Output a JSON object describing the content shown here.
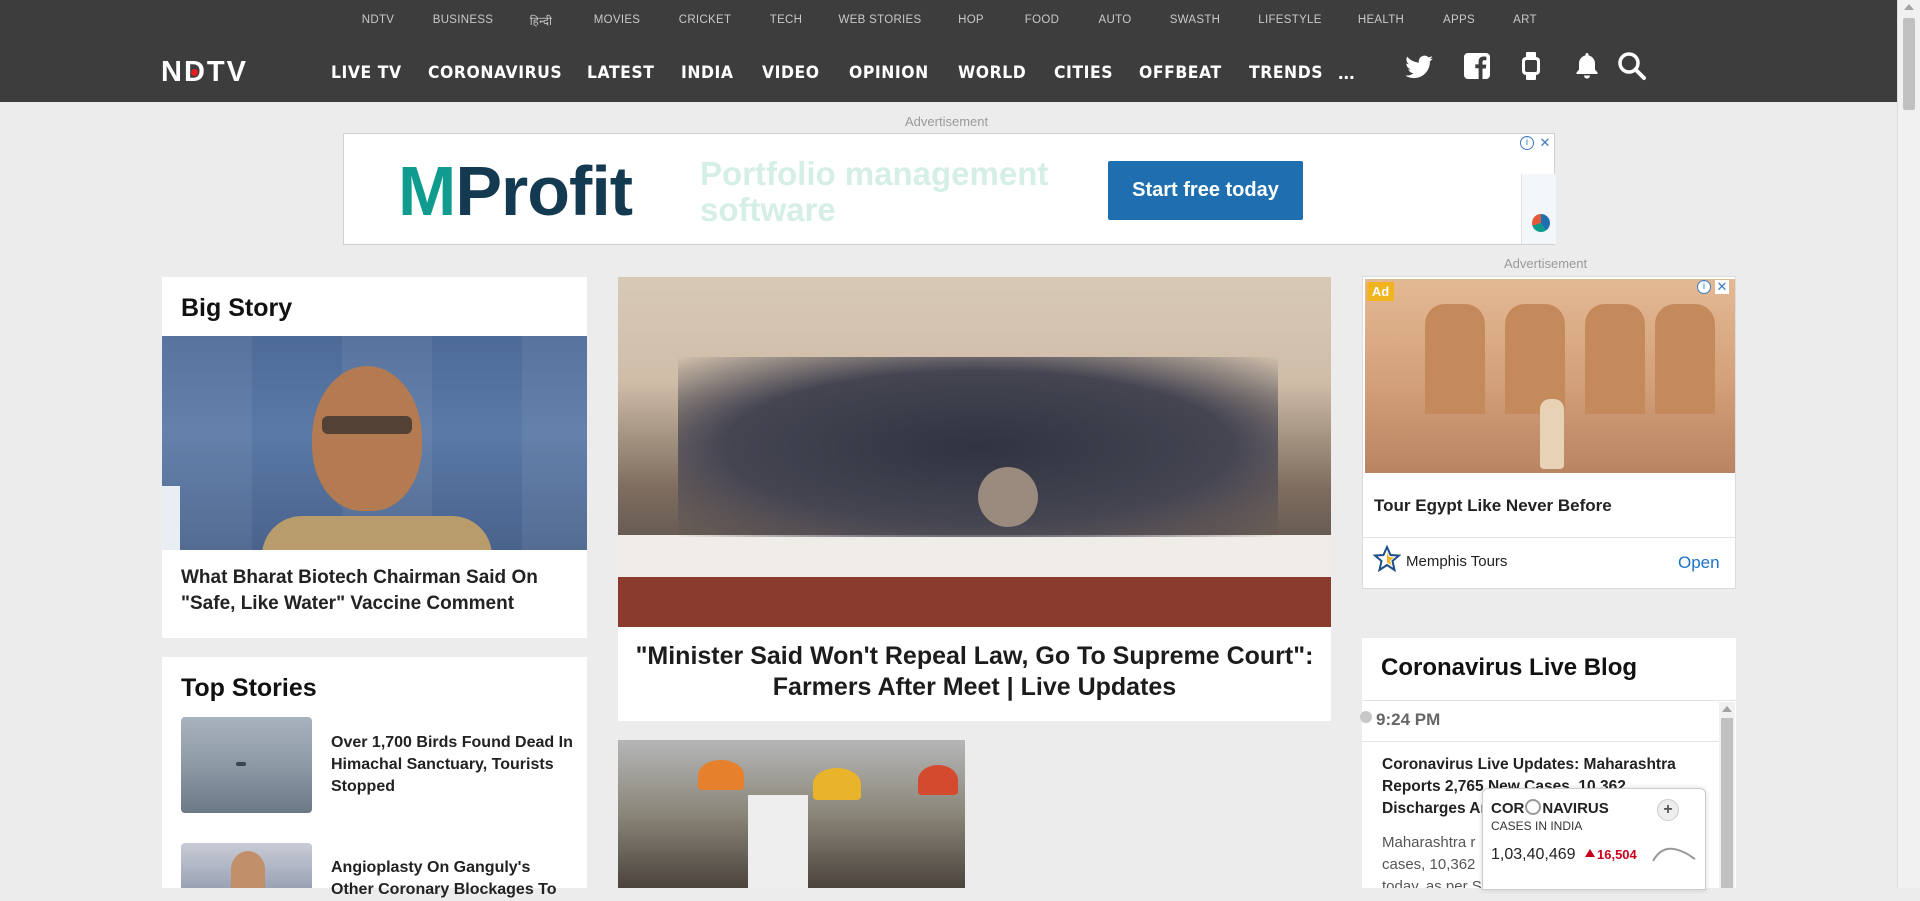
{
  "top_nav": [
    "NDTV",
    "BUSINESS",
    "हिन्दी",
    "MOVIES",
    "CRICKET",
    "TECH",
    "WEB STORIES",
    "HOP",
    "FOOD",
    "AUTO",
    "SWASTH",
    "LIFESTYLE",
    "HEALTH",
    "APPS",
    "ART"
  ],
  "logo": "NDTV",
  "main_nav": [
    "LIVE TV",
    "CORONAVIRUS",
    "LATEST",
    "INDIA",
    "VIDEO",
    "OPINION",
    "WORLD",
    "CITIES",
    "OFFBEAT",
    "TRENDS"
  ],
  "more_label": "...",
  "header_icons": [
    "twitter-icon",
    "facebook-icon",
    "smartwatch-icon",
    "bell-icon",
    "search-icon"
  ],
  "ad_label": "Advertisement",
  "banner_ad": {
    "brand_m": "M",
    "brand_rest": "Profit",
    "tagline": "Portfolio management software",
    "cta": "Start free today"
  },
  "big_story": {
    "heading": "Big Story",
    "headline": "What Bharat Biotech Chairman Said On \"Safe, Like Water\" Vaccine Comment"
  },
  "top_stories": {
    "heading": "Top Stories",
    "items": [
      {
        "headline": "Over 1,700 Birds Found Dead In Himachal Sanctuary, Tourists Stopped"
      },
      {
        "headline": "Angioplasty On Ganguly's Other Coronary Blockages To"
      }
    ]
  },
  "lead_story": {
    "headline": "\"Minister Said Won't Repeal Law, Go To Supreme Court\": Farmers After Meet | Live Updates"
  },
  "side_ad": {
    "badge": "Ad",
    "title": "Tour Egypt Like Never Before",
    "advertiser": "Memphis Tours",
    "cta": "Open"
  },
  "live_blog": {
    "heading": "Coronavirus Live Blog",
    "time": "9:24 PM",
    "entry_title": "Coronavirus Live Updates: Maharashtra Reports 2,765 New Cases, 10,362 Discharges And",
    "entry_body": "Maharashtra r cases, 10,362 today, as per S"
  },
  "covid_widget": {
    "title_a": "COR",
    "title_b": "NAVIRUS",
    "subtitle": "CASES IN INDIA",
    "total": "1,03,40,469",
    "increase": "16,504",
    "plus": "+"
  },
  "colors": {
    "header_bg": "#3d3d3d",
    "page_bg": "#ececec",
    "accent_red": "#c9001c",
    "link_blue": "#1f6fb0"
  }
}
